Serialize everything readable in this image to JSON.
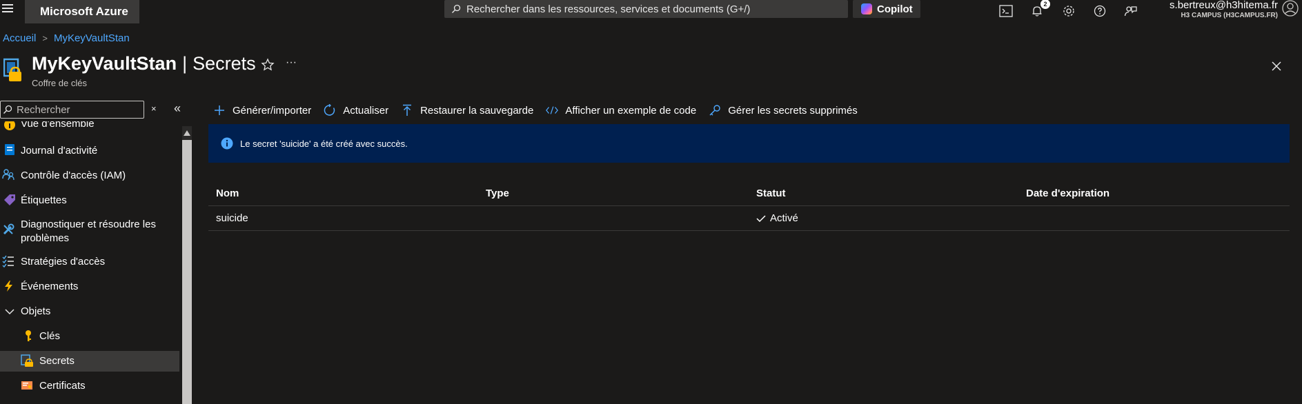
{
  "app": {
    "brand": "Microsoft Azure",
    "search_placeholder": "Rechercher dans les ressources, services et documents (G+/)",
    "copilot_label": "Copilot",
    "notification_count": "2",
    "account_email": "s.bertreux@h3hitema.fr",
    "account_tenant": "H3 CAMPUS (H3CAMPUS.FR)"
  },
  "breadcrumb": [
    {
      "label": "Accueil"
    },
    {
      "label": "MyKeyVaultStan"
    }
  ],
  "header": {
    "resource_name": "MyKeyVaultStan",
    "separator": "|",
    "section": "Secrets",
    "subtitle": "Coffre de clés",
    "more": "···"
  },
  "sidebar": {
    "search_placeholder": "Rechercher",
    "clear": "×",
    "collapse": "«",
    "items": [
      {
        "label": "Vue d'ensemble",
        "icon": "overview-icon"
      },
      {
        "label": "Journal d'activité",
        "icon": "activity-log-icon"
      },
      {
        "label": "Contrôle d'accès (IAM)",
        "icon": "iam-icon"
      },
      {
        "label": "Étiquettes",
        "icon": "tag-icon"
      },
      {
        "label": "Diagnostiquer et résoudre les problèmes",
        "icon": "wrench-icon"
      },
      {
        "label": "Stratégies d'accès",
        "icon": "access-policies-icon"
      },
      {
        "label": "Événements",
        "icon": "lightning-icon"
      },
      {
        "label": "Objets",
        "icon": "chevron-down-icon"
      },
      {
        "label": "Clés",
        "icon": "key-icon"
      },
      {
        "label": "Secrets",
        "icon": "secret-icon",
        "selected": true
      },
      {
        "label": "Certificats",
        "icon": "certificate-icon"
      }
    ]
  },
  "toolbar": {
    "generate": "Générer/importer",
    "refresh": "Actualiser",
    "restore": "Restaurer la sauvegarde",
    "code": "Afficher un exemple de code",
    "manage_deleted": "Gérer les secrets supprimés"
  },
  "notice": {
    "message": "Le secret 'suicide' a été créé avec succès."
  },
  "table": {
    "columns": [
      "Nom",
      "Type",
      "Statut",
      "Date d'expiration"
    ],
    "rows": [
      {
        "name": "suicide",
        "type": "",
        "status": "Activé",
        "expiration": ""
      }
    ]
  },
  "colors": {
    "accent": "#4ea8ff",
    "notice_bg": "#002050",
    "background": "#1b1a19"
  }
}
